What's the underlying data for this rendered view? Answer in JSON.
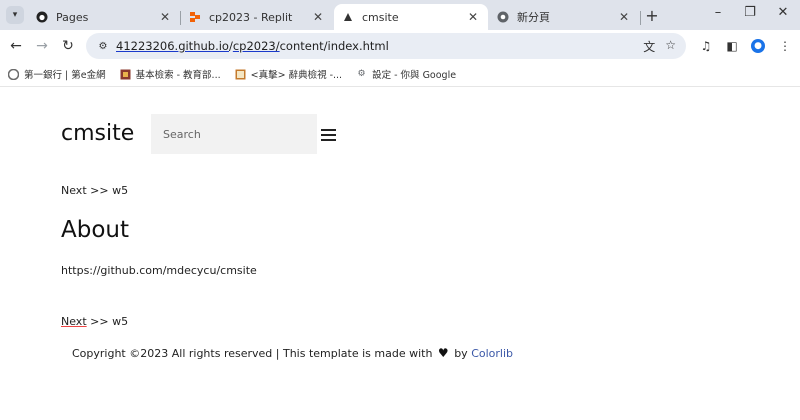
{
  "tabs": [
    {
      "title": "Pages",
      "icon": "github-icon"
    },
    {
      "title": "cp2023 - Replit",
      "icon": "replit-icon"
    },
    {
      "title": "cmsite",
      "icon": "site-icon",
      "active": true
    },
    {
      "title": "新分頁",
      "icon": "chrome-icon"
    }
  ],
  "toolbar": {
    "url_host": "41223206.github.io",
    "url_sep": "/",
    "url_repo": "cp2023/",
    "url_path": "content/index.html"
  },
  "bookmarks": [
    {
      "label": "第一銀行 | 第e金網"
    },
    {
      "label": "基本檢索 - 教育部..."
    },
    {
      "label": "<真擊> 辭典檢視 -..."
    },
    {
      "label": "設定 - 你與 Google"
    }
  ],
  "page": {
    "logo": "cmsite",
    "search_placeholder": "Search",
    "nav_top": {
      "next": "Next",
      "sep": " >> ",
      "target": "w5"
    },
    "heading": "About",
    "repo_url": "https://github.com/mdecycu/cmsite",
    "nav_bottom": {
      "next": "Next",
      "sep": " >> ",
      "target": "w5"
    },
    "footer_text": "Copyright ©2023 All rights reserved | This template is made with",
    "footer_by": "by",
    "footer_link": "Colorlib"
  },
  "colors": {
    "tabstrip": "#dfe3eb",
    "omnibox": "#e9edf4",
    "link_footer": "#3b58a8",
    "search_bg": "#f2f2f2"
  }
}
